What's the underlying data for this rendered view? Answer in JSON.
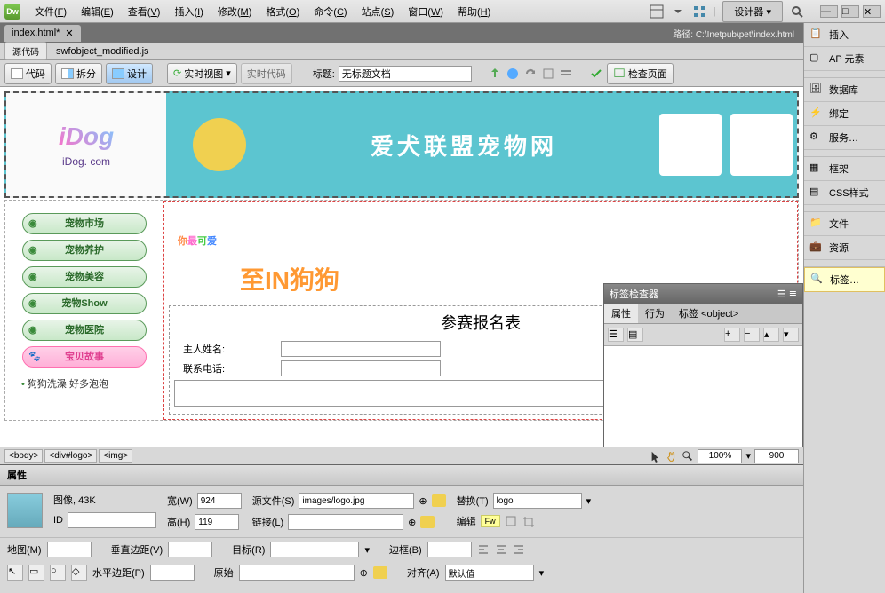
{
  "app_icon": "Dw",
  "menus": [
    {
      "label": "文件",
      "key": "F"
    },
    {
      "label": "编辑",
      "key": "E"
    },
    {
      "label": "查看",
      "key": "V"
    },
    {
      "label": "插入",
      "key": "I"
    },
    {
      "label": "修改",
      "key": "M"
    },
    {
      "label": "格式",
      "key": "O"
    },
    {
      "label": "命令",
      "key": "C"
    },
    {
      "label": "站点",
      "key": "S"
    },
    {
      "label": "窗口",
      "key": "W"
    },
    {
      "label": "帮助",
      "key": "H"
    }
  ],
  "designer_label": "设计器",
  "doc_tab": "index.html*",
  "path_info": "路径: C:\\Inetpub\\pet\\index.html",
  "sub_tabs": {
    "source": "源代码",
    "js": "swfobject_modified.js"
  },
  "view_buttons": {
    "code": "代码",
    "split": "拆分",
    "design": "设计",
    "live": "实时视图",
    "livecode": "实时代码"
  },
  "title_label": "标题:",
  "title_value": "无标题文档",
  "inspect_label": "检查页面",
  "banner": {
    "logo": "iDog",
    "url": "iDog. com",
    "title": "爱犬联盟宠物网"
  },
  "nav_items": [
    "宠物市场",
    "宠物养护",
    "宠物美容",
    "宠物Show",
    "宠物医院"
  ],
  "story_btn": "宝贝故事",
  "sidebar_link": "狗狗洗澡 好多泡泡",
  "cute_chars": [
    "你",
    "最",
    "可",
    "爱"
  ],
  "in_text": "至IN狗狗",
  "form": {
    "title": "参赛报名表",
    "owner": "主人姓名:",
    "phone": "联系电话:"
  },
  "breadcrumbs": [
    "<body>",
    "<div#logo>",
    "<img>"
  ],
  "zoom": "100%",
  "canvas_width": "900",
  "properties": {
    "header": "属性",
    "image_label": "图像, 43K",
    "id_label": "ID",
    "width_label": "宽(W)",
    "width_val": "924",
    "height_label": "高(H)",
    "height_val": "119",
    "src_label": "源文件(S)",
    "src_val": "images/logo.jpg",
    "link_label": "链接(L)",
    "alt_label": "替换(T)",
    "alt_val": "logo",
    "edit_label": "编辑",
    "map_label": "地图(M)",
    "vspace_label": "垂直边距(V)",
    "hspace_label": "水平边距(P)",
    "target_label": "目标(R)",
    "orig_label": "原始",
    "border_label": "边框(B)",
    "align_label": "对齐(A)",
    "align_val": "默认值"
  },
  "right_panels": [
    "插入",
    "AP 元素",
    "数据库",
    "绑定",
    "服务…",
    "框架",
    "CSS样式",
    "文件",
    "资源",
    "标签…"
  ],
  "tag_inspector": {
    "title": "标签检查器",
    "tabs": {
      "attr": "属性",
      "behavior": "行为"
    },
    "tag_label": "标签 <object>"
  }
}
